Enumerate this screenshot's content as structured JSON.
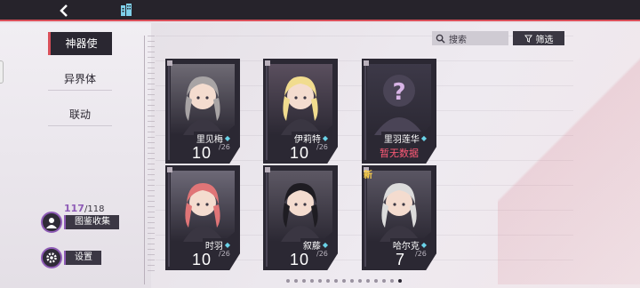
{
  "nav": {
    "back_glyph": "<",
    "city_icon": "building-icon"
  },
  "tabs": [
    {
      "label": "神器使",
      "active": true
    },
    {
      "label": "异界体",
      "active": false
    },
    {
      "label": "联动",
      "active": false
    }
  ],
  "collection": {
    "current": "117",
    "total": "/118",
    "button_label": "图鉴收集"
  },
  "settings": {
    "label": "设置"
  },
  "search": {
    "placeholder": "搜索"
  },
  "filter": {
    "label": "筛选"
  },
  "cards": [
    {
      "name": "里见梅",
      "level": "10",
      "max": "/26",
      "locked": false,
      "new": false,
      "hair": "#a8a4a5",
      "bg": "#6e6a74"
    },
    {
      "name": "伊莉特",
      "level": "10",
      "max": "/26",
      "locked": false,
      "new": false,
      "hair": "#f1dc8e",
      "bg": "#5a4f5e"
    },
    {
      "name": "里羽莲华",
      "level": "",
      "max": "",
      "locked": true,
      "nodata": "暂无数据",
      "new": false,
      "hair": "#3d3948",
      "bg": "#3d3948"
    },
    {
      "name": "时羽",
      "level": "10",
      "max": "/26",
      "locked": false,
      "new": false,
      "hair": "#e07577",
      "bg": "#6d6977"
    },
    {
      "name": "叙藤",
      "level": "10",
      "max": "/26",
      "locked": false,
      "new": false,
      "hair": "#1e1c22",
      "bg": "#5d5864"
    },
    {
      "name": "哈尔克",
      "level": "7",
      "max": "/26",
      "locked": false,
      "new": true,
      "new_label": "新",
      "hair": "#dcdcdc",
      "bg": "#5a5663"
    }
  ],
  "pager": {
    "count": 15,
    "active": 14
  },
  "colors": {
    "accent": "#d9505a",
    "purple": "#8e5bb6",
    "dark": "#2a2731"
  }
}
